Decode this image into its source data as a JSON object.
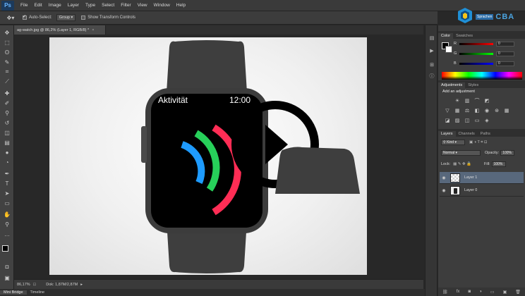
{
  "app": {
    "logo": "Ps"
  },
  "menu": [
    "File",
    "Edit",
    "Image",
    "Layer",
    "Type",
    "Select",
    "Filter",
    "View",
    "Window",
    "Help"
  ],
  "options": {
    "auto_select_label": "Auto-Select:",
    "auto_select_value": "Group",
    "show_transform_label": "Show Transform Controls"
  },
  "brand": {
    "tag": "Sprachen",
    "name": "CBA"
  },
  "document": {
    "tab_title": "ag-watch.jpg @ 86,2% (Layer 1, RGB/8) *",
    "zoom": "86,17%",
    "doc_info": "Dok: 1,87M/2,87M"
  },
  "canvas": {
    "watch_title": "Aktivität",
    "watch_time": "12:00",
    "ring_colors": {
      "move": "#ff2d55",
      "exercise": "#27d05a",
      "stand": "#1e9bff"
    }
  },
  "bottom_tabs": [
    "Mini Bridge",
    "Timeline"
  ],
  "color_panel": {
    "tabs": [
      "Color",
      "Swatches"
    ],
    "rows": [
      {
        "label": "R",
        "value": "0"
      },
      {
        "label": "G",
        "value": "0"
      },
      {
        "label": "B",
        "value": "0"
      }
    ]
  },
  "adjustments_panel": {
    "tabs": [
      "Adjustments",
      "Styles"
    ],
    "heading": "Add an adjustment"
  },
  "layers_panel": {
    "tabs": [
      "Layers",
      "Channels",
      "Paths"
    ],
    "kind_label": "Kind",
    "blend_mode": "Normal",
    "opacity_label": "Opacity:",
    "opacity_value": "100%",
    "lock_label": "Lock:",
    "fill_label": "Fill:",
    "fill_value": "100%",
    "layers": [
      {
        "name": "Layer 1",
        "active": true
      },
      {
        "name": "Layer 0",
        "active": false
      }
    ]
  }
}
